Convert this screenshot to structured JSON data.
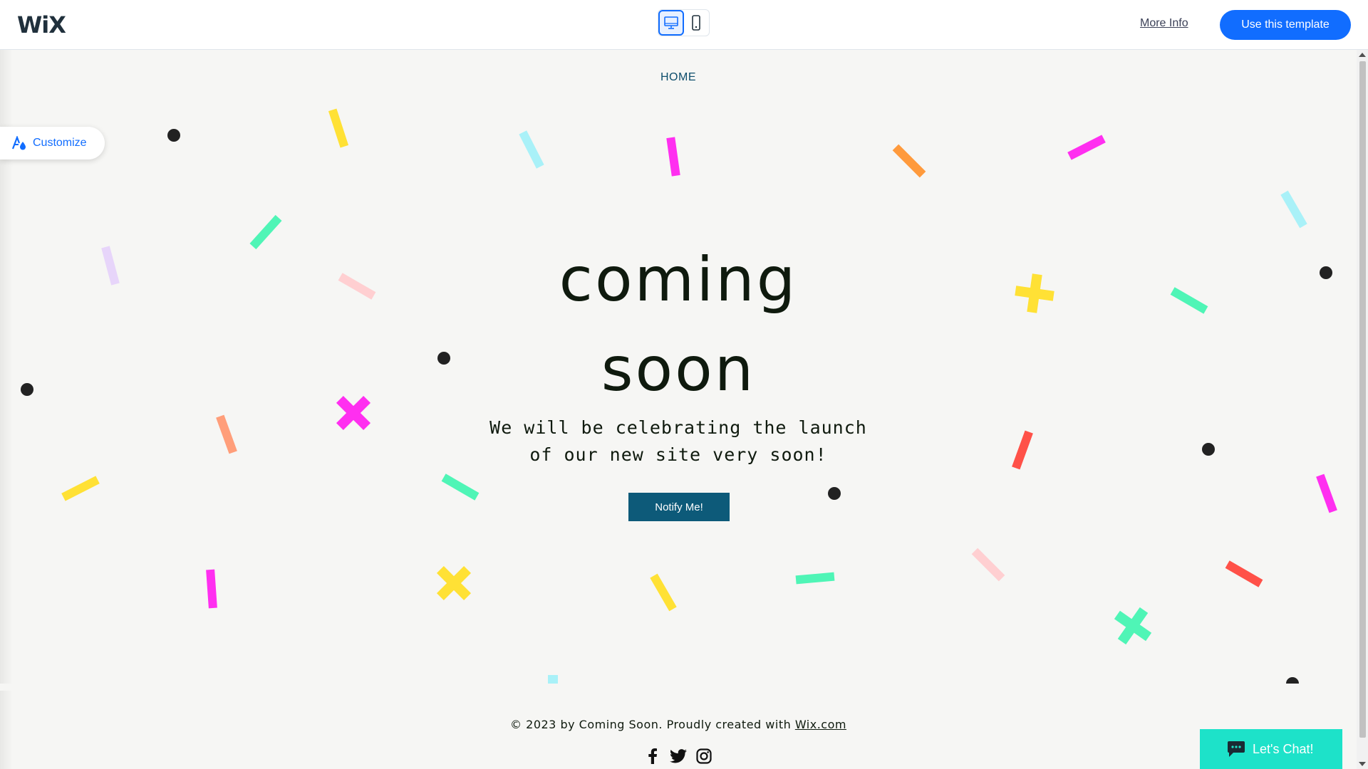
{
  "topbar": {
    "logo": "WiX",
    "more_info": "More Info",
    "use_template": "Use this template",
    "devices": [
      "desktop-icon",
      "mobile-icon"
    ]
  },
  "site": {
    "nav": {
      "home": "HOME"
    },
    "customize": "Customize",
    "headline_line1": "coming",
    "headline_line2": "soon",
    "subline_line1": "We will be celebrating the launch",
    "subline_line2": "of our new site very soon!",
    "notify": "Notify Me!",
    "footer_text": "© 2023 by Coming Soon. Proudly created with ",
    "footer_link": "Wix.com",
    "social": [
      "facebook-icon",
      "twitter-icon",
      "instagram-icon"
    ],
    "chat": "Let's Chat!"
  },
  "colors": {
    "accent": "#116dff",
    "button": "#0d5a79",
    "chat": "#1de2c9",
    "background": "#f6f6f4",
    "confetti": [
      "#ffe135",
      "#a9f1f8",
      "#ff2ff0",
      "#ff9a3c",
      "#4ff5b6",
      "#e7d5fa",
      "#ffcfd1",
      "#ff9e7a",
      "#ff5148",
      "#222222"
    ]
  }
}
